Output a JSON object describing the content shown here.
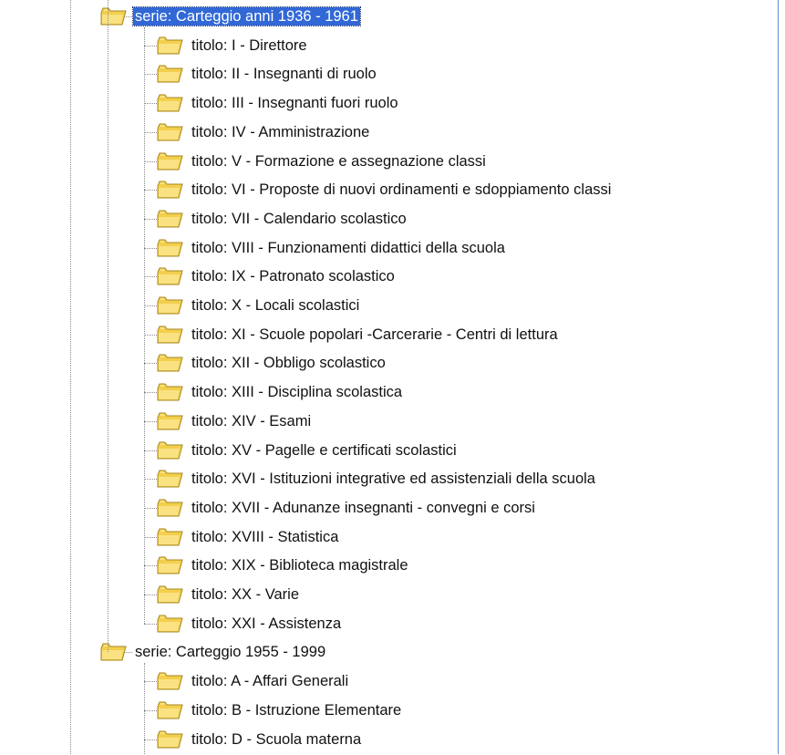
{
  "colors": {
    "selection_bg": "#3168d6",
    "selection_fg": "#ffffff",
    "folder_fill": "#f3cf4d",
    "tree_line": "#8a8a8a",
    "frame_border": "#5b8fd4"
  },
  "icons": {
    "node": "folder-icon",
    "expander": "minus-box-icon"
  },
  "tree": {
    "series": [
      {
        "label": "serie: Carteggio anni 1936 - 1961",
        "selected": true,
        "expanded": true,
        "children": [
          {
            "label": "titolo: I - Direttore"
          },
          {
            "label": "titolo: II -  Insegnanti di ruolo"
          },
          {
            "label": "titolo: III - Insegnanti fuori ruolo"
          },
          {
            "label": "titolo: IV - Amministrazione"
          },
          {
            "label": "titolo: V -  Formazione e assegnazione classi"
          },
          {
            "label": "titolo: VI -  Proposte di nuovi ordinamenti e sdoppiamento classi"
          },
          {
            "label": "titolo: VII - Calendario scolastico"
          },
          {
            "label": "titolo: VIII - Funzionamenti didattici della scuola"
          },
          {
            "label": "titolo: IX -  Patronato scolastico"
          },
          {
            "label": "titolo: X - Locali scolastici"
          },
          {
            "label": "titolo: XI - Scuole popolari -Carcerarie - Centri di lettura"
          },
          {
            "label": "titolo: XII - Obbligo scolastico"
          },
          {
            "label": "titolo: XIII - Disciplina scolastica"
          },
          {
            "label": "titolo: XIV - Esami"
          },
          {
            "label": "titolo: XV - Pagelle e certificati scolastici"
          },
          {
            "label": "titolo: XVI -  Istituzioni integrative ed assistenziali della scuola"
          },
          {
            "label": "titolo: XVII - Adunanze insegnanti - convegni e corsi"
          },
          {
            "label": "titolo: XVIII - Statistica"
          },
          {
            "label": "titolo: XIX - Biblioteca magistrale"
          },
          {
            "label": "titolo: XX - Varie"
          },
          {
            "label": "titolo: XXI - Assistenza"
          }
        ]
      },
      {
        "label": "serie: Carteggio 1955 - 1999",
        "selected": false,
        "expanded": true,
        "children": [
          {
            "label": "titolo: A - Affari Generali"
          },
          {
            "label": "titolo: B - Istruzione Elementare"
          },
          {
            "label": "titolo: D - Scuola materna"
          }
        ]
      }
    ]
  }
}
